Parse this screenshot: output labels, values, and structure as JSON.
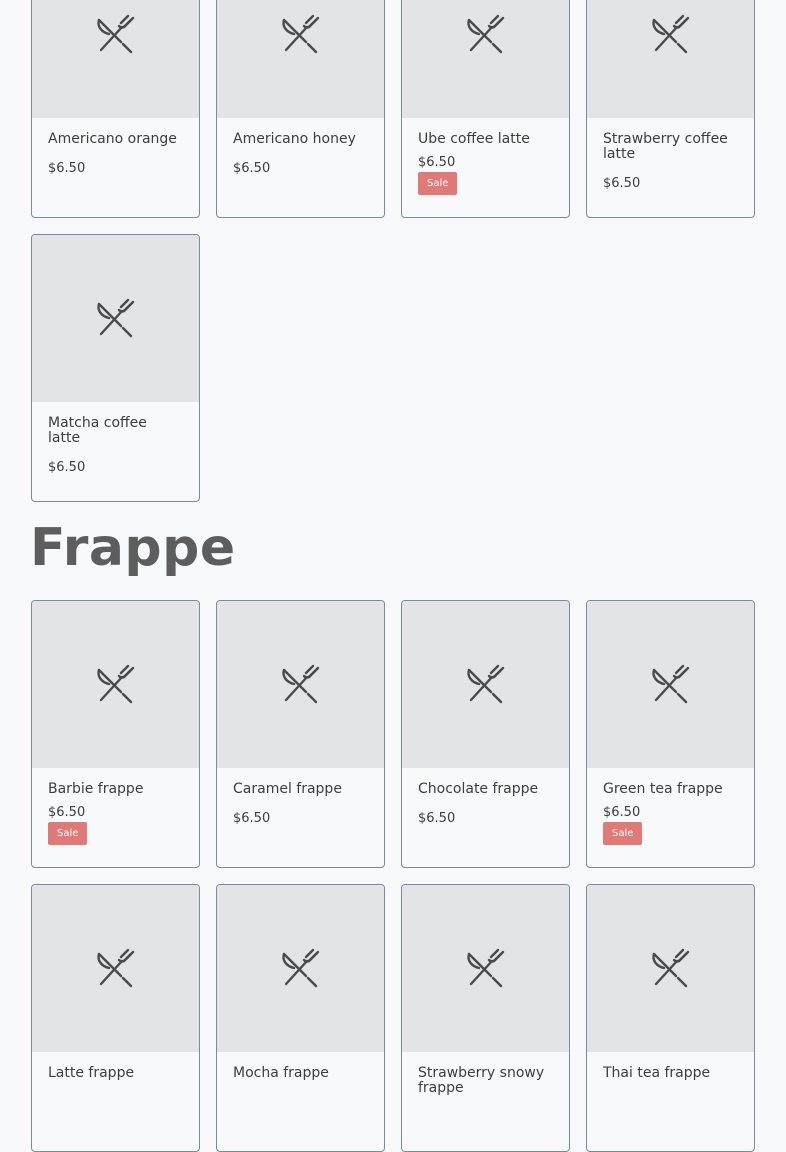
{
  "top_products": [
    {
      "name": "Americano orange",
      "price": "$6.50",
      "sale": ""
    },
    {
      "name": "Americano honey",
      "price": "$6.50",
      "sale": ""
    },
    {
      "name": "Ube coffee latte",
      "price": "$6.50",
      "sale": "Sale"
    },
    {
      "name": "Strawberry coffee latte",
      "price": "$6.50",
      "sale": ""
    },
    {
      "name": "Matcha coffee latte",
      "price": "$6.50",
      "sale": ""
    }
  ],
  "frappe_section": {
    "title": "Frappe",
    "products": [
      {
        "name": "Barbie frappe",
        "price": "$6.50",
        "sale": "Sale"
      },
      {
        "name": "Caramel frappe",
        "price": "$6.50",
        "sale": ""
      },
      {
        "name": "Chocolate frappe",
        "price": "$6.50",
        "sale": ""
      },
      {
        "name": "Green tea frappe",
        "price": "$6.50",
        "sale": "Sale"
      },
      {
        "name": "Latte frappe",
        "price": "",
        "sale": ""
      },
      {
        "name": "Mocha frappe",
        "price": "",
        "sale": ""
      },
      {
        "name": "Strawberry snowy frappe",
        "price": "",
        "sale": ""
      },
      {
        "name": "Thai tea frappe",
        "price": "",
        "sale": ""
      }
    ]
  },
  "placeholder_icon": "fork-knife-icon",
  "colors": {
    "badge": "#e07a78",
    "thumb": "#e3e4e6",
    "border": "#7a8aa6"
  }
}
